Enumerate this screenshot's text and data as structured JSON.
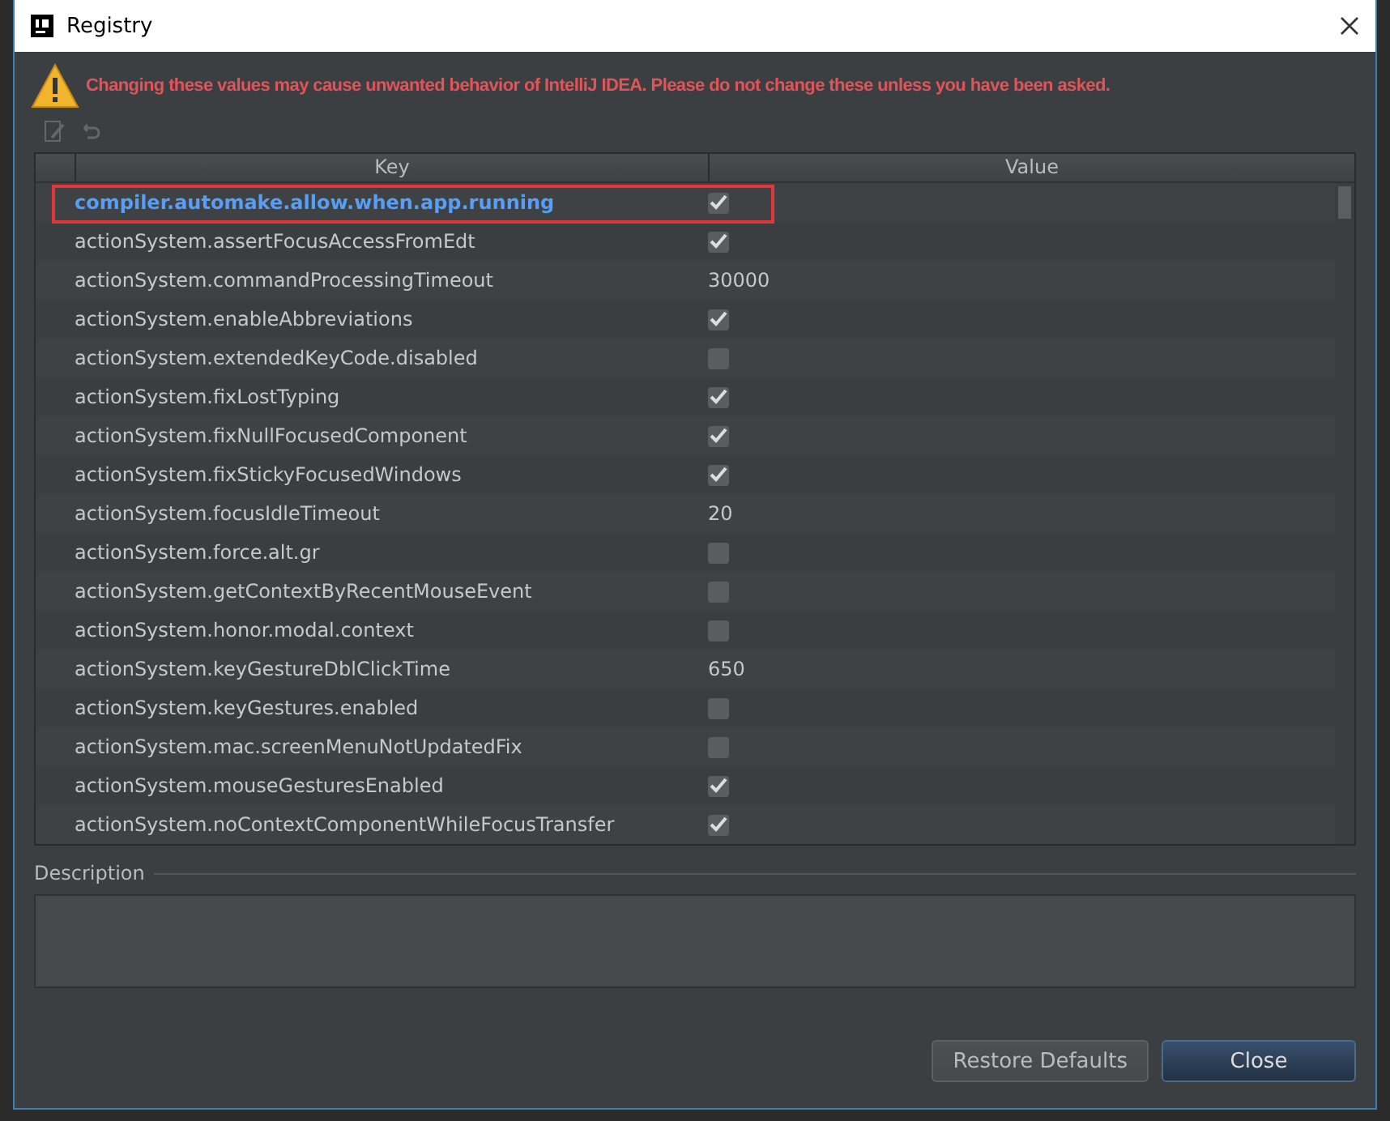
{
  "window": {
    "title": "Registry"
  },
  "warning": "Changing these values may cause unwanted behavior of IntelliJ IDEA. Please do not change these unless you have been asked.",
  "table": {
    "columns": [
      "Key",
      "Value"
    ],
    "rows": [
      {
        "key": "compiler.automake.allow.when.app.running",
        "kind": "checkbox",
        "checked": true,
        "selected": true,
        "outlined": true
      },
      {
        "key": "actionSystem.assertFocusAccessFromEdt",
        "kind": "checkbox",
        "checked": true,
        "selected": false,
        "outlined": false
      },
      {
        "key": "actionSystem.commandProcessingTimeout",
        "kind": "text",
        "value": "30000",
        "selected": false,
        "outlined": false
      },
      {
        "key": "actionSystem.enableAbbreviations",
        "kind": "checkbox",
        "checked": true,
        "selected": false,
        "outlined": false
      },
      {
        "key": "actionSystem.extendedKeyCode.disabled",
        "kind": "checkbox",
        "checked": false,
        "selected": false,
        "outlined": false
      },
      {
        "key": "actionSystem.fixLostTyping",
        "kind": "checkbox",
        "checked": true,
        "selected": false,
        "outlined": false
      },
      {
        "key": "actionSystem.fixNullFocusedComponent",
        "kind": "checkbox",
        "checked": true,
        "selected": false,
        "outlined": false
      },
      {
        "key": "actionSystem.fixStickyFocusedWindows",
        "kind": "checkbox",
        "checked": true,
        "selected": false,
        "outlined": false
      },
      {
        "key": "actionSystem.focusIdleTimeout",
        "kind": "text",
        "value": "20",
        "selected": false,
        "outlined": false
      },
      {
        "key": "actionSystem.force.alt.gr",
        "kind": "checkbox",
        "checked": false,
        "selected": false,
        "outlined": false
      },
      {
        "key": "actionSystem.getContextByRecentMouseEvent",
        "kind": "checkbox",
        "checked": false,
        "selected": false,
        "outlined": false
      },
      {
        "key": "actionSystem.honor.modal.context",
        "kind": "checkbox",
        "checked": false,
        "selected": false,
        "outlined": false
      },
      {
        "key": "actionSystem.keyGestureDblClickTime",
        "kind": "text",
        "value": "650",
        "selected": false,
        "outlined": false
      },
      {
        "key": "actionSystem.keyGestures.enabled",
        "kind": "checkbox",
        "checked": false,
        "selected": false,
        "outlined": false
      },
      {
        "key": "actionSystem.mac.screenMenuNotUpdatedFix",
        "kind": "checkbox",
        "checked": false,
        "selected": false,
        "outlined": false
      },
      {
        "key": "actionSystem.mouseGesturesEnabled",
        "kind": "checkbox",
        "checked": true,
        "selected": false,
        "outlined": false
      },
      {
        "key": "actionSystem.noContextComponentWhileFocusTransfer",
        "kind": "checkbox",
        "checked": true,
        "selected": false,
        "outlined": false
      }
    ]
  },
  "description": {
    "label": "Description"
  },
  "buttons": [
    "Restore Defaults",
    "Close"
  ]
}
